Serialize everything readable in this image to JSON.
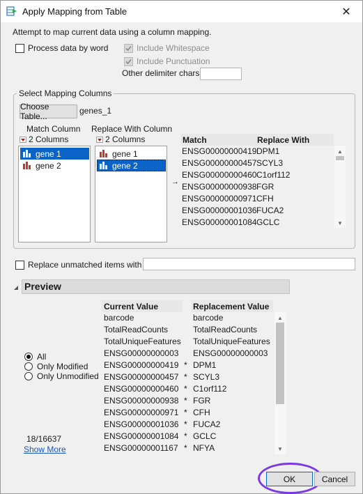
{
  "window": {
    "title": "Apply Mapping from Table",
    "close_glyph": "✕"
  },
  "intro_text": "Attempt to map current data using a column mapping.",
  "options": {
    "process_by_word": {
      "label": "Process data by word",
      "checked": false
    },
    "include_whitespace": {
      "label": "Include Whitespace",
      "checked": true,
      "enabled": false
    },
    "include_punctuation": {
      "label": "Include Punctuation",
      "checked": true,
      "enabled": false
    },
    "other_delimiter": {
      "label": "Other delimiter chars",
      "value": ""
    }
  },
  "mapping": {
    "group_label": "Select Mapping Columns",
    "choose_table_label": "Choose Table...",
    "table_name": "genes_1",
    "match_column": {
      "header": "Match Column",
      "count_label": "2 Columns",
      "items": [
        {
          "label": "gene 1",
          "selected": true
        },
        {
          "label": "gene 2",
          "selected": false
        }
      ]
    },
    "replace_column": {
      "header": "Replace With Column",
      "count_label": "2 Columns",
      "items": [
        {
          "label": "gene 1",
          "selected": false
        },
        {
          "label": "gene 2",
          "selected": true
        }
      ]
    },
    "arrow": "→",
    "preview_table": {
      "headers": [
        "Match",
        "Replace With"
      ],
      "rows": [
        [
          "ENSG00000000419",
          "DPM1"
        ],
        [
          "ENSG00000000457",
          "SCYL3"
        ],
        [
          "ENSG00000000460",
          "C1orf112"
        ],
        [
          "ENSG00000000938",
          "FGR"
        ],
        [
          "ENSG00000000971",
          "CFH"
        ],
        [
          "ENSG00000001036",
          "FUCA2"
        ],
        [
          "ENSG00000001084",
          "GCLC"
        ]
      ]
    }
  },
  "replace_unmatched": {
    "label": "Replace unmatched items with",
    "checked": false,
    "value": ""
  },
  "preview": {
    "title": "Preview",
    "filters": [
      {
        "label": "All",
        "selected": true
      },
      {
        "label": "Only Modified",
        "selected": false
      },
      {
        "label": "Only Unmodified",
        "selected": false
      }
    ],
    "count": "18/16637",
    "show_more": "Show More",
    "headers": [
      "Current Value",
      "Replacement Value"
    ],
    "rows": [
      {
        "current": "barcode",
        "mark": "",
        "replacement": "barcode"
      },
      {
        "current": "TotalReadCounts",
        "mark": "",
        "replacement": "TotalReadCounts"
      },
      {
        "current": "TotalUniqueFeatures",
        "mark": "",
        "replacement": "TotalUniqueFeatures"
      },
      {
        "current": "ENSG00000000003",
        "mark": "",
        "replacement": "ENSG00000000003"
      },
      {
        "current": "ENSG00000000419",
        "mark": "*",
        "replacement": "DPM1"
      },
      {
        "current": "ENSG00000000457",
        "mark": "*",
        "replacement": "SCYL3"
      },
      {
        "current": "ENSG00000000460",
        "mark": "*",
        "replacement": "C1orf112"
      },
      {
        "current": "ENSG00000000938",
        "mark": "*",
        "replacement": "FGR"
      },
      {
        "current": "ENSG00000000971",
        "mark": "*",
        "replacement": "CFH"
      },
      {
        "current": "ENSG00000001036",
        "mark": "*",
        "replacement": "FUCA2"
      },
      {
        "current": "ENSG00000001084",
        "mark": "*",
        "replacement": "GCLC"
      },
      {
        "current": "ENSG00000001167",
        "mark": "*",
        "replacement": "NFYA"
      }
    ]
  },
  "buttons": {
    "ok": "OK",
    "cancel": "Cancel"
  },
  "colors": {
    "selection": "#0a64c8",
    "bar_icon": "#c0392b",
    "highlight_ring": "#7a3be0",
    "link": "#1a56b8"
  },
  "icons": {
    "title": "table-mapping-icon",
    "column": "bar-chart-icon",
    "dropdown": "red-triangle-icon"
  }
}
